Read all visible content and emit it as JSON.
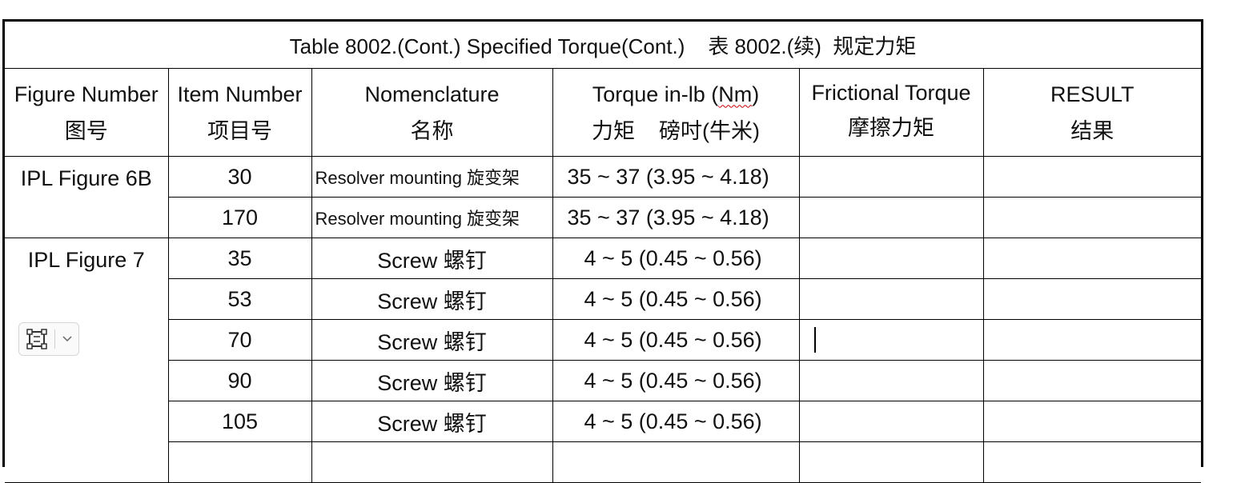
{
  "table": {
    "title": "Table 8002.(Cont.) Specified Torque(Cont.)    表 8002.(续)  规定力矩",
    "headers": {
      "figure": {
        "en": "Figure Number",
        "zh": "图号"
      },
      "item": {
        "en": "Item Number",
        "zh": "项目号"
      },
      "nomenclature": {
        "en": "Nomenclature",
        "zh": "名称"
      },
      "torque": {
        "en_pre": "Torque in-lb (",
        "en_mid": "Nm",
        "en_post": ")",
        "zh": "力矩    磅吋(牛米)"
      },
      "frictional": {
        "en": "Frictional Torque",
        "zh": "摩擦力矩"
      },
      "result": {
        "en": "RESULT",
        "zh": "结果"
      }
    },
    "groups": [
      {
        "figure": "IPL Figure 6B",
        "rows": [
          {
            "item": "30",
            "nomenclature": "Resolver mounting 旋变架",
            "torque": "35 ~ 37 (3.95 ~ 4.18)",
            "frictional": "",
            "result": ""
          },
          {
            "item": "170",
            "nomenclature": "Resolver mounting 旋变架",
            "torque": "35 ~ 37 (3.95 ~ 4.18)",
            "frictional": "",
            "result": ""
          }
        ]
      },
      {
        "figure": "IPL Figure 7",
        "rows": [
          {
            "item": "35",
            "nomenclature": "Screw 螺钉",
            "torque": "4 ~ 5 (0.45 ~ 0.56)",
            "frictional": "",
            "result": ""
          },
          {
            "item": "53",
            "nomenclature": "Screw 螺钉",
            "torque": "4 ~ 5 (0.45 ~ 0.56)",
            "frictional": "",
            "result": ""
          },
          {
            "item": "70",
            "nomenclature": "Screw 螺钉",
            "torque": "4 ~ 5 (0.45 ~ 0.56)",
            "frictional": "",
            "result": ""
          },
          {
            "item": "90",
            "nomenclature": "Screw 螺钉",
            "torque": "4 ~ 5 (0.45 ~ 0.56)",
            "frictional": "",
            "result": ""
          },
          {
            "item": "105",
            "nomenclature": "Screw 螺钉",
            "torque": "4 ~ 5 (0.45 ~ 0.56)",
            "frictional": "",
            "result": ""
          }
        ]
      }
    ]
  },
  "widget": {
    "icon": "frame-select-icon",
    "dropdown_icon": "chevron-down-icon"
  }
}
